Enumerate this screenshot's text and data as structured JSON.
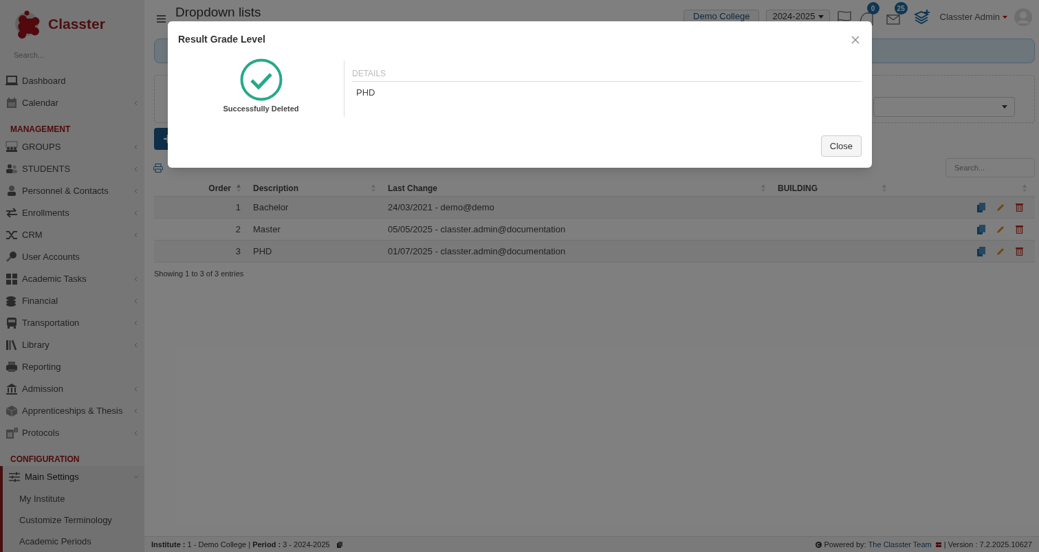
{
  "brand": {
    "name": "Classter"
  },
  "sidebar": {
    "search_placeholder": "Search...",
    "sections": [
      {
        "items": [
          {
            "label": "Dashboard",
            "has_submenu": false
          },
          {
            "label": "Calendar",
            "has_submenu": true
          }
        ]
      },
      {
        "heading": "MANAGEMENT",
        "items": [
          {
            "label": "GROUPS",
            "has_submenu": true
          },
          {
            "label": "STUDENTS",
            "has_submenu": true
          },
          {
            "label": "Personnel & Contacts",
            "has_submenu": true
          },
          {
            "label": "Enrollments",
            "has_submenu": true
          },
          {
            "label": "CRM",
            "has_submenu": true
          },
          {
            "label": "User Accounts",
            "has_submenu": false
          },
          {
            "label": "Academic Tasks",
            "has_submenu": true
          },
          {
            "label": "Financial",
            "has_submenu": true
          },
          {
            "label": "Transportation",
            "has_submenu": true
          },
          {
            "label": "Library",
            "has_submenu": true
          },
          {
            "label": "Reporting",
            "has_submenu": false
          },
          {
            "label": "Admission",
            "has_submenu": true
          },
          {
            "label": "Apprenticeships & Thesis",
            "has_submenu": true
          },
          {
            "label": "Protocols",
            "has_submenu": true
          }
        ]
      },
      {
        "heading": "CONFIGURATION",
        "items": [
          {
            "label": "Main Settings",
            "has_submenu": true,
            "expanded": true,
            "children": [
              {
                "label": "My Institute"
              },
              {
                "label": "Customize Terminology"
              },
              {
                "label": "Academic Periods"
              }
            ]
          }
        ]
      }
    ]
  },
  "header": {
    "title": "Dropdown lists",
    "institute": "Demo College",
    "period": "2024-2025",
    "notifications": "0",
    "messages": "25",
    "user": "Classter Admin"
  },
  "table": {
    "search_placeholder": "Search...",
    "columns": [
      "Order",
      "Description",
      "Last Change",
      "BUILDING"
    ],
    "rows": [
      {
        "order": "1",
        "description": "Bachelor",
        "last_change": "24/03/2021 - demo@demo"
      },
      {
        "order": "2",
        "description": "Master",
        "last_change": "05/05/2025 - classter.admin@documentation"
      },
      {
        "order": "3",
        "description": "PHD",
        "last_change": "01/07/2025 - classter.admin@documentation"
      }
    ],
    "info": "Showing 1 to 3 of 3 entries"
  },
  "footer": {
    "context": "**Institute :** 1 - Demo College | **Period :** 3 - 2024-2025",
    "powered_by": "Powered by:",
    "team_link": "The Classter Team",
    "version": "| Version : 7.2.2025.10627"
  },
  "modal": {
    "title": "Result Grade Level",
    "status": "Successfully Deleted",
    "details_heading": "DETAILS",
    "details": [
      "PHD"
    ],
    "close_button": "Close"
  }
}
